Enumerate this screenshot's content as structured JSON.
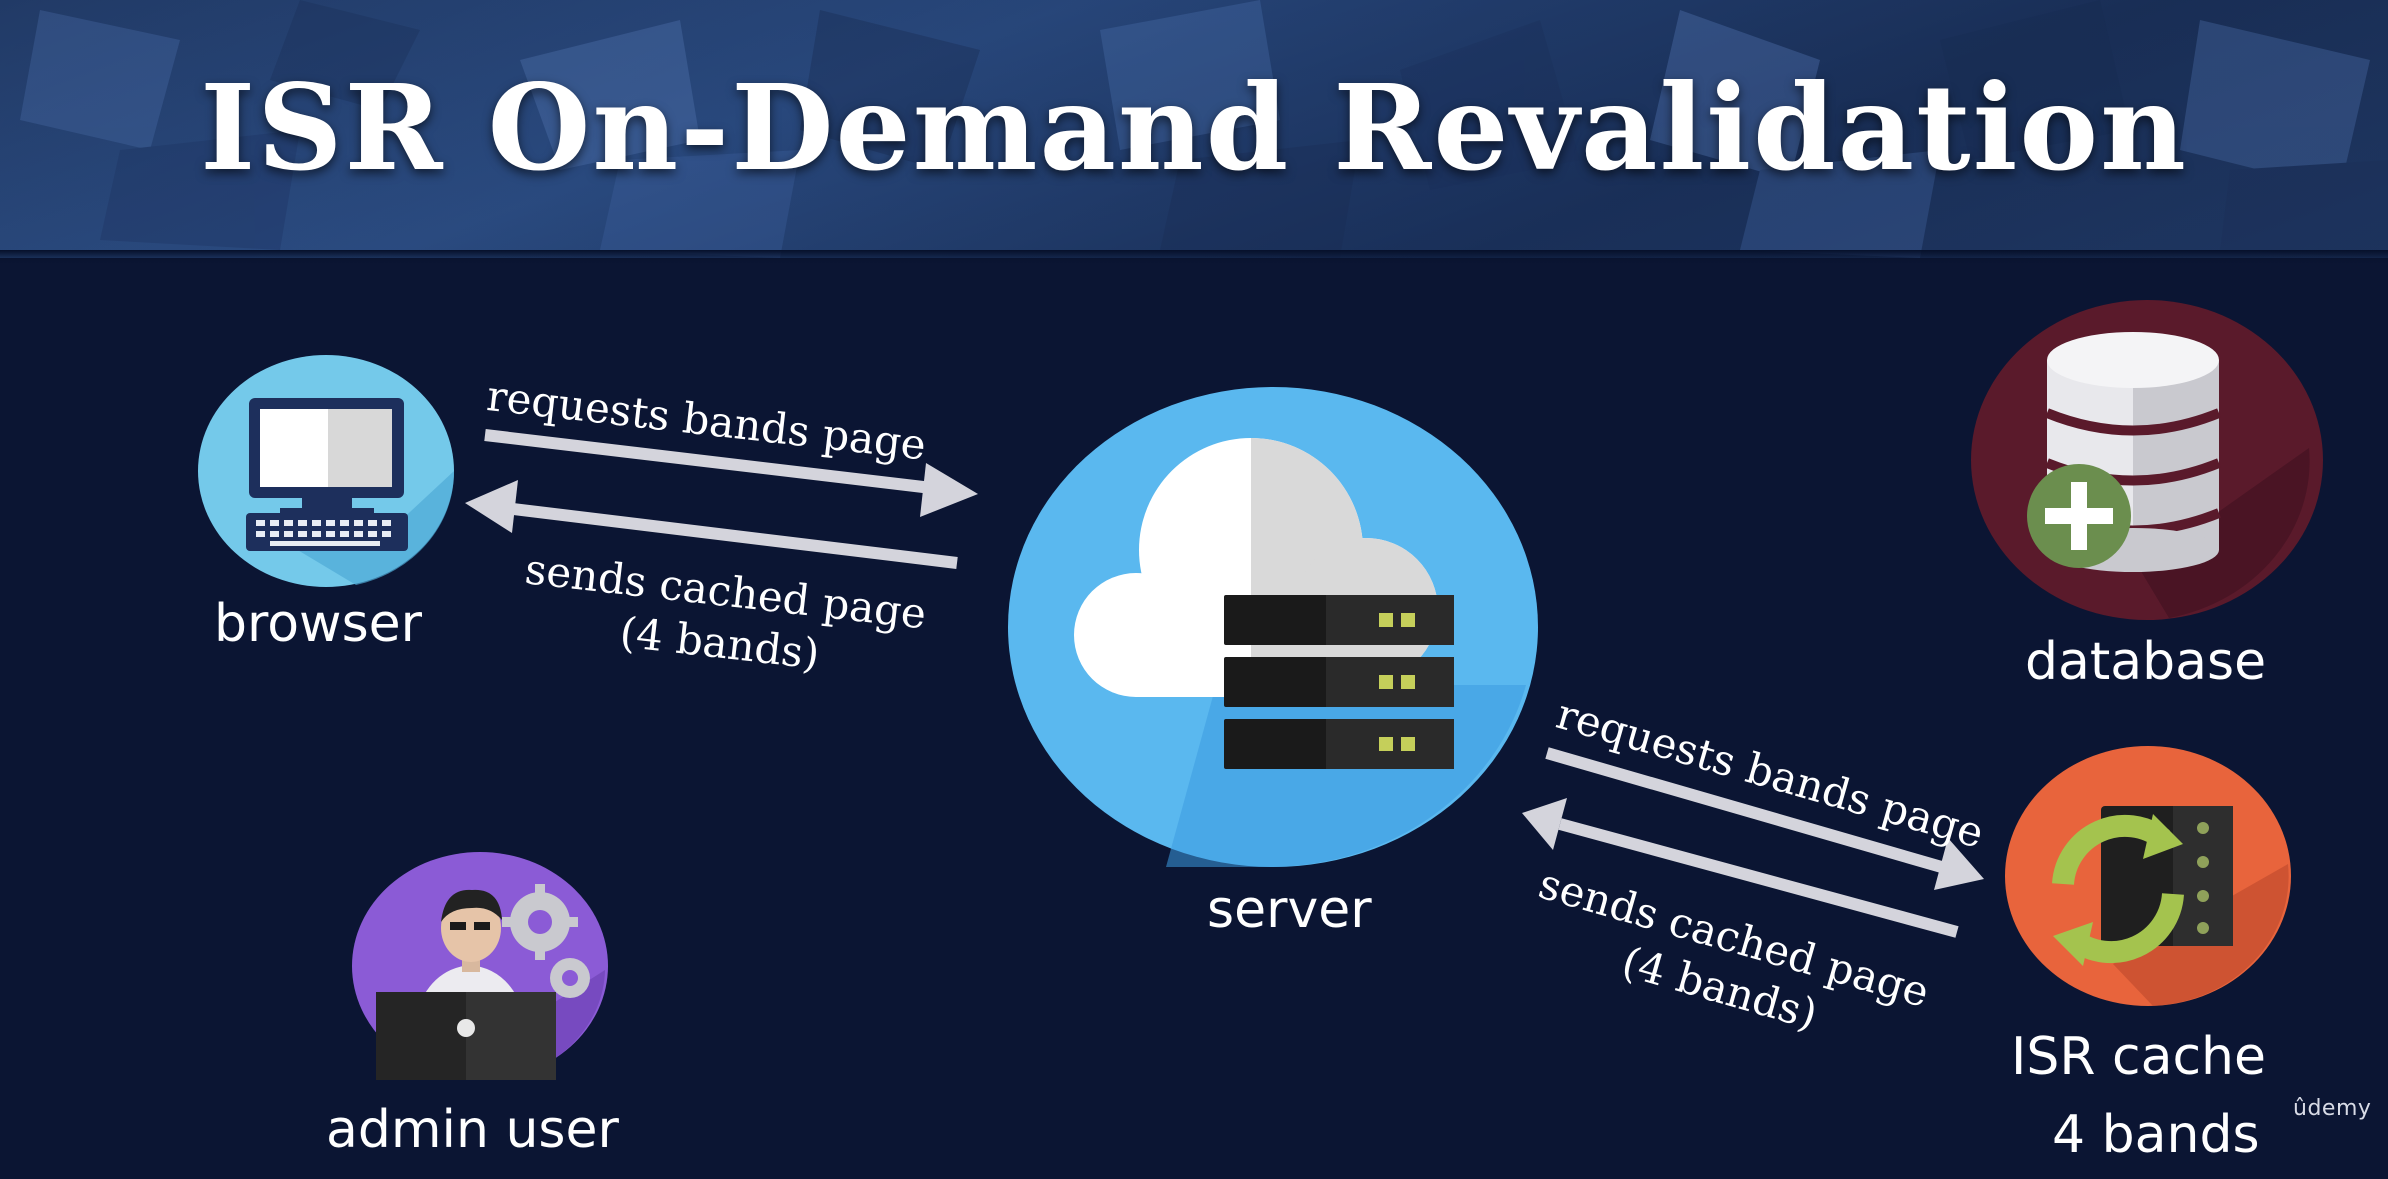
{
  "title": "ISR On-Demand Revalidation",
  "nodes": {
    "browser": {
      "label": "browser",
      "icon": "monitor-icon"
    },
    "server": {
      "label": "server",
      "icon": "cloud-server-icon"
    },
    "database": {
      "label": "database",
      "icon": "database-add-icon"
    },
    "isr_cache": {
      "label_line1": "ISR cache",
      "label_line2": "4 bands",
      "icon": "cache-refresh-icon"
    },
    "admin": {
      "label": "admin user",
      "icon": "admin-laptop-icon"
    }
  },
  "edges": {
    "browser_to_server": "requests bands page",
    "server_to_browser_line1": "sends cached page",
    "server_to_browser_line2": "(4 bands)",
    "server_to_cache": "requests bands page",
    "cache_to_server_line1": "sends cached page",
    "cache_to_server_line2": "(4 bands)"
  },
  "watermark": "ûdemy",
  "colors": {
    "background": "#0b1533",
    "browser_circle": "#6fc6e8",
    "server_circle": "#56b4ee",
    "database_circle": "#5a1a2b",
    "cache_circle": "#e8643c",
    "admin_circle": "#8b5bd6",
    "arrow": "#d4d4dc"
  }
}
